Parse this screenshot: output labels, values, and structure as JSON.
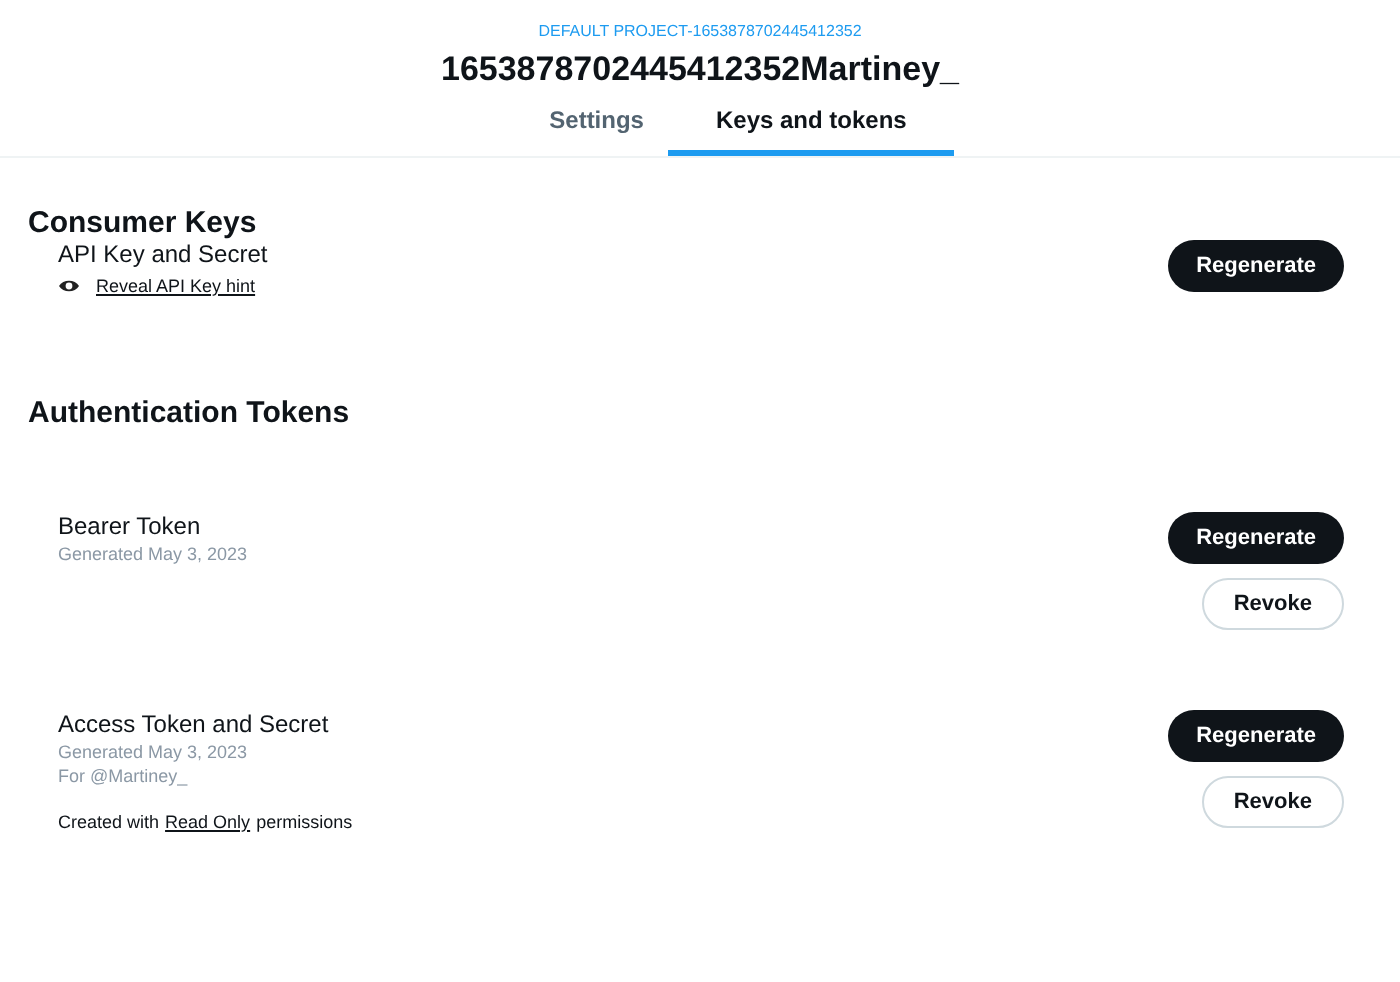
{
  "header": {
    "project": "DEFAULT PROJECT-1653878702445412352",
    "app_name": "1653878702445412352Martiney_"
  },
  "tabs": [
    {
      "label": "Settings",
      "selected": false
    },
    {
      "label": "Keys and tokens",
      "selected": true
    }
  ],
  "sections": [
    {
      "title": "Consumer Keys",
      "items": [
        {
          "name": "API Key and Secret",
          "link": "Reveal API Key hint",
          "buttons": [
            {
              "label": "Regenerate",
              "kind": "primary"
            }
          ]
        }
      ]
    },
    {
      "title": "Authentication Tokens",
      "items": [
        {
          "name": "Bearer Token",
          "details": [
            "Generated May 3, 2023"
          ],
          "buttons": [
            {
              "label": "Regenerate",
              "kind": "primary"
            },
            {
              "label": "Revoke",
              "kind": "secondary"
            }
          ]
        },
        {
          "name": "Access Token and Secret",
          "details": [
            "Generated May 3, 2023",
            "For @Martiney_"
          ],
          "note": {
            "before": "Created with",
            "link": "Read Only",
            "after": "permissions"
          },
          "buttons": [
            {
              "label": "Regenerate",
              "kind": "primary"
            },
            {
              "label": "Revoke",
              "kind": "secondary"
            }
          ]
        }
      ]
    }
  ]
}
